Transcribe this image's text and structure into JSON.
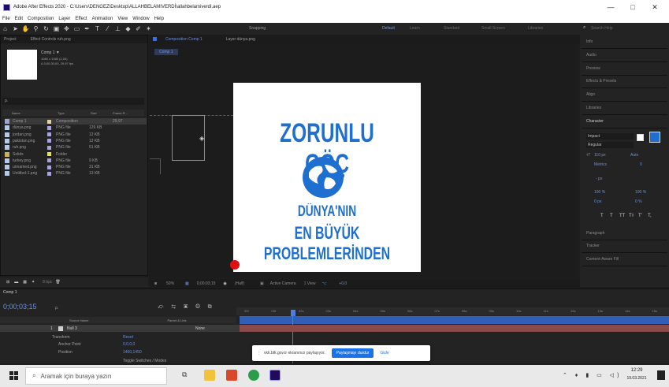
{
  "window": {
    "title": "Adobe After Effects 2020 - C:\\Users\\DENGEZ\\Desktop\\ALLAHBELAMIVERDİ\\allahbelamiverdi.aep",
    "controls": [
      "—",
      "□",
      "✕"
    ]
  },
  "menu": [
    "File",
    "Edit",
    "Composition",
    "Layer",
    "Effect",
    "Animation",
    "View",
    "Window",
    "Help"
  ],
  "toolbar": {
    "snapping": "Snapping",
    "workspaces": [
      "Default",
      "Learn",
      "Standard",
      "Small Screen",
      "Libraries"
    ],
    "search_placeholder": "Search Help"
  },
  "project": {
    "tab": "Project",
    "effect_tab": "Effect Controls ruh.png",
    "comp_name": "Comp 1 ▼",
    "comp_info_1": "1080 x 1080 (1,00)",
    "comp_info_2": "Δ 0;00;30;00, 29,97 fps",
    "search_placeholder": "ρ.",
    "columns": [
      "Name",
      "Type",
      "Size",
      "Frame R..."
    ],
    "files": [
      {
        "name": "Comp 1",
        "type": "Composition",
        "size": "",
        "fps": "29,97",
        "color": "#e0d2a8",
        "icon": "comp"
      },
      {
        "name": "dünya.png",
        "type": "PNG file",
        "size": "129 KB",
        "fps": "",
        "color": "#a9a4d8",
        "icon": "file"
      },
      {
        "name": "jordan.png",
        "type": "PNG file",
        "size": "12 KB",
        "fps": "",
        "color": "#a9a4d8",
        "icon": "file"
      },
      {
        "name": "pakistan.png",
        "type": "PNG file",
        "size": "12 KB",
        "fps": "",
        "color": "#a9a4d8",
        "icon": "file"
      },
      {
        "name": "ruh.png",
        "type": "PNG file",
        "size": "51 KB",
        "fps": "",
        "color": "#a9a4d8",
        "icon": "file"
      },
      {
        "name": "Solids",
        "type": "Folder",
        "size": "",
        "fps": "",
        "color": "#e7e05b",
        "icon": "folder"
      },
      {
        "name": "turkey.png",
        "type": "PNG file",
        "size": "9 KB",
        "fps": "",
        "color": "#a9a4d8",
        "icon": "file"
      },
      {
        "name": "unnamed.png",
        "type": "PNG file",
        "size": "31 KB",
        "fps": "",
        "color": "#a9a4d8",
        "icon": "file"
      },
      {
        "name": "Untitled-1.png",
        "type": "PNG file",
        "size": "13 KB",
        "fps": "",
        "color": "#a9a4d8",
        "icon": "file"
      }
    ],
    "bpc": "8 bpc"
  },
  "composition": {
    "tab": "Composition Comp 1",
    "layer_tab": "Layer dünya.png",
    "breadcrumb": "Comp 1",
    "poster": {
      "headline": "ZORUNLU GÖÇ",
      "line2": "DÜNYA'NIN",
      "line3": "EN BÜYÜK PROBLEMLERİNDEN"
    },
    "footer": {
      "zoom": "50%",
      "timecode": "0;00;03;15",
      "resolution": "(Half)",
      "camera": "Active Camera",
      "view": "1 View",
      "offset": "+0,0"
    }
  },
  "right_panel": {
    "sections": [
      "Info",
      "Audio",
      "Preview",
      "Effects & Presets",
      "Align",
      "Libraries",
      "Character",
      "Paragraph",
      "Tracker",
      "Content-Aware Fill"
    ],
    "character": {
      "font": "Impact",
      "style": "Regular",
      "size": "110 px",
      "leading": "Auto",
      "kerning": "Metrics",
      "tracking": "0",
      "stroke": "- px",
      "vscale": "100 %",
      "hscale": "100 %",
      "baseline": "0 px",
      "tsume": "0 %",
      "type_buttons": [
        "T",
        "T",
        "TT",
        "Tт",
        "T'",
        "T,"
      ]
    }
  },
  "timeline": {
    "tab": "Comp 1",
    "timecode": "0;00;03;15",
    "search_placeholder": "ρ.",
    "columns": [
      "Source Name",
      "Parent & Link"
    ],
    "layer": {
      "index": "1",
      "name": "Null 3",
      "parent": "None"
    },
    "transform": "Transform",
    "reset": "Reset",
    "properties": [
      {
        "name": "Anchor Point",
        "value": "0,0,0,0"
      },
      {
        "name": "Position",
        "value": "1460,1450"
      }
    ],
    "ruler": [
      "00f",
      "00f",
      "02s",
      "03s",
      "04s",
      "05s",
      "06s",
      "07s",
      "08s",
      "09s",
      "10s",
      "11s",
      "12s",
      "13s",
      "14s",
      "15s"
    ],
    "toggle": "Toggle Switches / Modes"
  },
  "share_banner": {
    "message": "vkk.btk.gov.tr ekranınızı paylaşıyor.",
    "stop": "Paylaşmayı durdur",
    "hide": "Gizle"
  },
  "taskbar": {
    "search_placeholder": "Aramak için buraya yazın",
    "time": "12:29",
    "date": "19.03.2021"
  }
}
